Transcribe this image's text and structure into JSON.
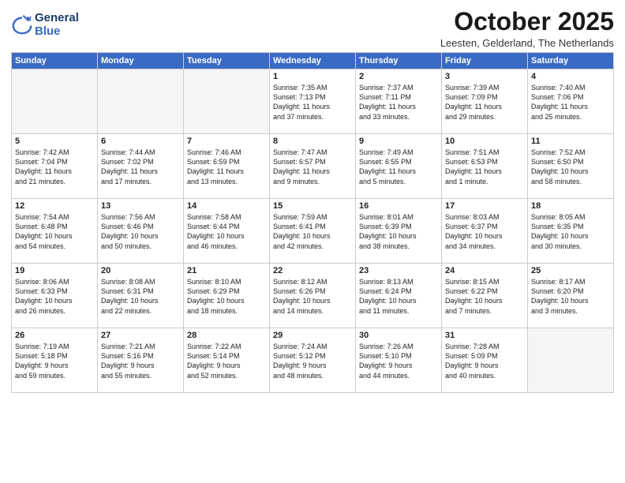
{
  "logo": {
    "line1": "General",
    "line2": "Blue"
  },
  "title": "October 2025",
  "subtitle": "Leesten, Gelderland, The Netherlands",
  "days_of_week": [
    "Sunday",
    "Monday",
    "Tuesday",
    "Wednesday",
    "Thursday",
    "Friday",
    "Saturday"
  ],
  "weeks": [
    [
      {
        "day": "",
        "empty": true
      },
      {
        "day": "",
        "empty": true
      },
      {
        "day": "",
        "empty": true
      },
      {
        "day": "1",
        "info": "Sunrise: 7:35 AM\nSunset: 7:13 PM\nDaylight: 11 hours\nand 37 minutes."
      },
      {
        "day": "2",
        "info": "Sunrise: 7:37 AM\nSunset: 7:11 PM\nDaylight: 11 hours\nand 33 minutes."
      },
      {
        "day": "3",
        "info": "Sunrise: 7:39 AM\nSunset: 7:09 PM\nDaylight: 11 hours\nand 29 minutes."
      },
      {
        "day": "4",
        "info": "Sunrise: 7:40 AM\nSunset: 7:06 PM\nDaylight: 11 hours\nand 25 minutes."
      }
    ],
    [
      {
        "day": "5",
        "info": "Sunrise: 7:42 AM\nSunset: 7:04 PM\nDaylight: 11 hours\nand 21 minutes."
      },
      {
        "day": "6",
        "info": "Sunrise: 7:44 AM\nSunset: 7:02 PM\nDaylight: 11 hours\nand 17 minutes."
      },
      {
        "day": "7",
        "info": "Sunrise: 7:46 AM\nSunset: 6:59 PM\nDaylight: 11 hours\nand 13 minutes."
      },
      {
        "day": "8",
        "info": "Sunrise: 7:47 AM\nSunset: 6:57 PM\nDaylight: 11 hours\nand 9 minutes."
      },
      {
        "day": "9",
        "info": "Sunrise: 7:49 AM\nSunset: 6:55 PM\nDaylight: 11 hours\nand 5 minutes."
      },
      {
        "day": "10",
        "info": "Sunrise: 7:51 AM\nSunset: 6:53 PM\nDaylight: 11 hours\nand 1 minute."
      },
      {
        "day": "11",
        "info": "Sunrise: 7:52 AM\nSunset: 6:50 PM\nDaylight: 10 hours\nand 58 minutes."
      }
    ],
    [
      {
        "day": "12",
        "info": "Sunrise: 7:54 AM\nSunset: 6:48 PM\nDaylight: 10 hours\nand 54 minutes."
      },
      {
        "day": "13",
        "info": "Sunrise: 7:56 AM\nSunset: 6:46 PM\nDaylight: 10 hours\nand 50 minutes."
      },
      {
        "day": "14",
        "info": "Sunrise: 7:58 AM\nSunset: 6:44 PM\nDaylight: 10 hours\nand 46 minutes."
      },
      {
        "day": "15",
        "info": "Sunrise: 7:59 AM\nSunset: 6:41 PM\nDaylight: 10 hours\nand 42 minutes."
      },
      {
        "day": "16",
        "info": "Sunrise: 8:01 AM\nSunset: 6:39 PM\nDaylight: 10 hours\nand 38 minutes."
      },
      {
        "day": "17",
        "info": "Sunrise: 8:03 AM\nSunset: 6:37 PM\nDaylight: 10 hours\nand 34 minutes."
      },
      {
        "day": "18",
        "info": "Sunrise: 8:05 AM\nSunset: 6:35 PM\nDaylight: 10 hours\nand 30 minutes."
      }
    ],
    [
      {
        "day": "19",
        "info": "Sunrise: 8:06 AM\nSunset: 6:33 PM\nDaylight: 10 hours\nand 26 minutes."
      },
      {
        "day": "20",
        "info": "Sunrise: 8:08 AM\nSunset: 6:31 PM\nDaylight: 10 hours\nand 22 minutes."
      },
      {
        "day": "21",
        "info": "Sunrise: 8:10 AM\nSunset: 6:29 PM\nDaylight: 10 hours\nand 18 minutes."
      },
      {
        "day": "22",
        "info": "Sunrise: 8:12 AM\nSunset: 6:26 PM\nDaylight: 10 hours\nand 14 minutes."
      },
      {
        "day": "23",
        "info": "Sunrise: 8:13 AM\nSunset: 6:24 PM\nDaylight: 10 hours\nand 11 minutes."
      },
      {
        "day": "24",
        "info": "Sunrise: 8:15 AM\nSunset: 6:22 PM\nDaylight: 10 hours\nand 7 minutes."
      },
      {
        "day": "25",
        "info": "Sunrise: 8:17 AM\nSunset: 6:20 PM\nDaylight: 10 hours\nand 3 minutes."
      }
    ],
    [
      {
        "day": "26",
        "info": "Sunrise: 7:19 AM\nSunset: 5:18 PM\nDaylight: 9 hours\nand 59 minutes."
      },
      {
        "day": "27",
        "info": "Sunrise: 7:21 AM\nSunset: 5:16 PM\nDaylight: 9 hours\nand 55 minutes."
      },
      {
        "day": "28",
        "info": "Sunrise: 7:22 AM\nSunset: 5:14 PM\nDaylight: 9 hours\nand 52 minutes."
      },
      {
        "day": "29",
        "info": "Sunrise: 7:24 AM\nSunset: 5:12 PM\nDaylight: 9 hours\nand 48 minutes."
      },
      {
        "day": "30",
        "info": "Sunrise: 7:26 AM\nSunset: 5:10 PM\nDaylight: 9 hours\nand 44 minutes."
      },
      {
        "day": "31",
        "info": "Sunrise: 7:28 AM\nSunset: 5:09 PM\nDaylight: 9 hours\nand 40 minutes."
      },
      {
        "day": "",
        "empty": true
      }
    ]
  ]
}
